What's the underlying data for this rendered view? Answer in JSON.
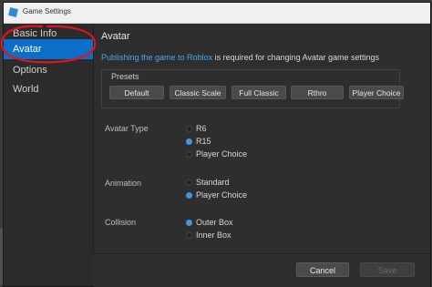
{
  "window": {
    "title": "Game Settings"
  },
  "sidebar": {
    "items": [
      {
        "label": "Basic Info"
      },
      {
        "label": "Avatar"
      },
      {
        "label": "Options"
      },
      {
        "label": "World"
      }
    ]
  },
  "main": {
    "heading": "Avatar",
    "notice_link": "Publishing the game to Roblox",
    "notice_text": " is required for changing Avatar game settings",
    "presets": {
      "label": "Presets",
      "buttons": [
        "Default",
        "Classic Scale",
        "Full Classic",
        "Rthro",
        "Player Choice"
      ]
    },
    "avatar_type": {
      "label": "Avatar Type",
      "options": [
        "R6",
        "R15",
        "Player Choice"
      ],
      "selected": "R15"
    },
    "animation": {
      "label": "Animation",
      "options": [
        "Standard",
        "Player Choice"
      ],
      "selected": "Player Choice"
    },
    "collision": {
      "label": "Collision",
      "options": [
        "Outer Box",
        "Inner Box"
      ],
      "selected": "Outer Box"
    }
  },
  "footer": {
    "cancel_label": "Cancel",
    "save_label": "Save"
  },
  "colors": {
    "accent": "#0b6ec8",
    "link": "#4aa6f0",
    "annotation": "#e0141e"
  }
}
